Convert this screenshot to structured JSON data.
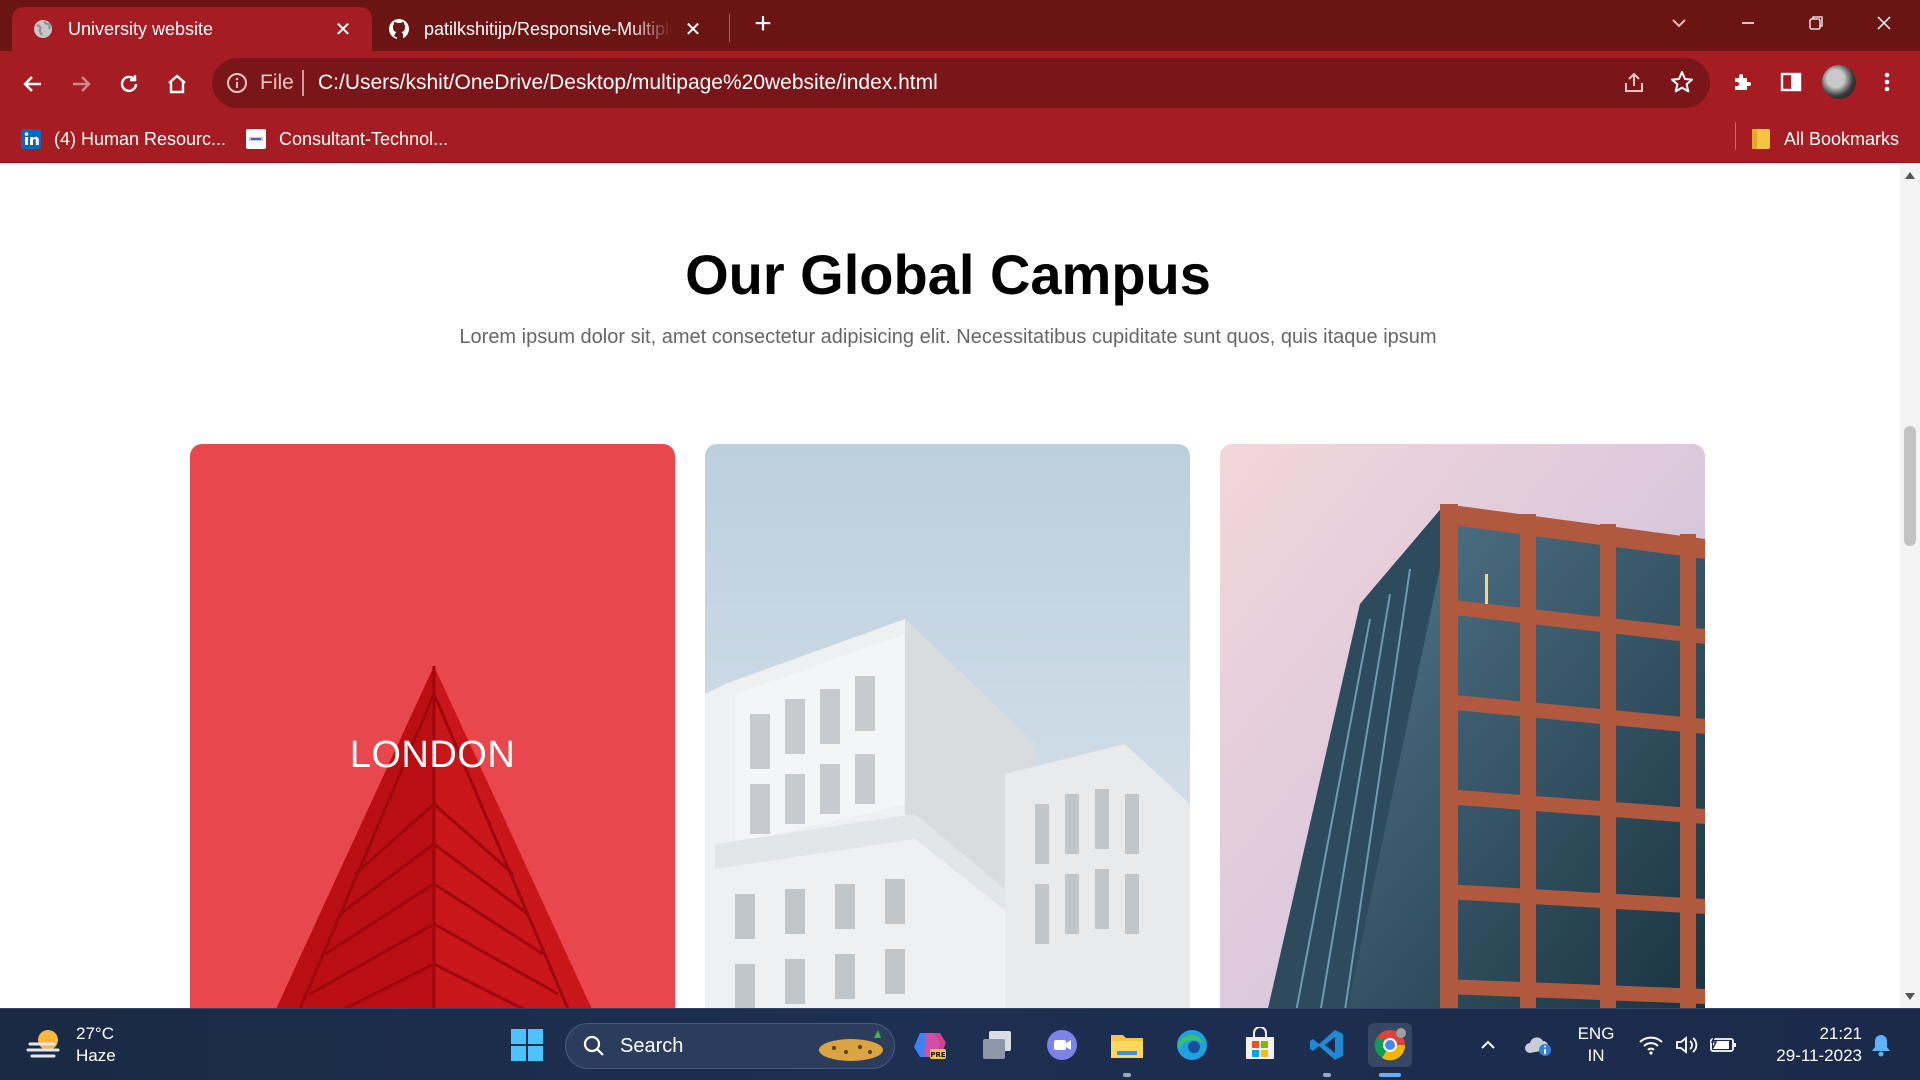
{
  "browser": {
    "tabs": [
      {
        "title": "University website",
        "active": true
      },
      {
        "title": "patilkshitijp/Responsive-Multiple",
        "active": false
      }
    ],
    "omnibox": {
      "scheme_label": "File",
      "url": "C:/Users/kshit/OneDrive/Desktop/multipage%20website/index.html"
    },
    "bookmarks": [
      {
        "label": "(4) Human Resourc...",
        "icon": "linkedin-icon"
      },
      {
        "label": "Consultant-Technol...",
        "icon": "site-icon"
      }
    ],
    "all_bookmarks_label": "All Bookmarks",
    "theme_color": "#a51d22"
  },
  "page": {
    "title": "Our Global Campus",
    "subtitle": "Lorem ipsum dolor sit, amet consectetur adipisicing elit. Necessitatibus cupiditate sunt quos, quis itaque ipsum",
    "cards": [
      {
        "label": "LONDON",
        "overlay_color": "#e8474d"
      },
      {
        "label": ""
      },
      {
        "label": ""
      }
    ]
  },
  "taskbar": {
    "weather": {
      "temp": "27°C",
      "condition": "Haze"
    },
    "search_placeholder": "Search",
    "language": {
      "line1": "ENG",
      "line2": "IN"
    },
    "clock": {
      "time": "21:21",
      "date": "29-11-2023"
    }
  }
}
